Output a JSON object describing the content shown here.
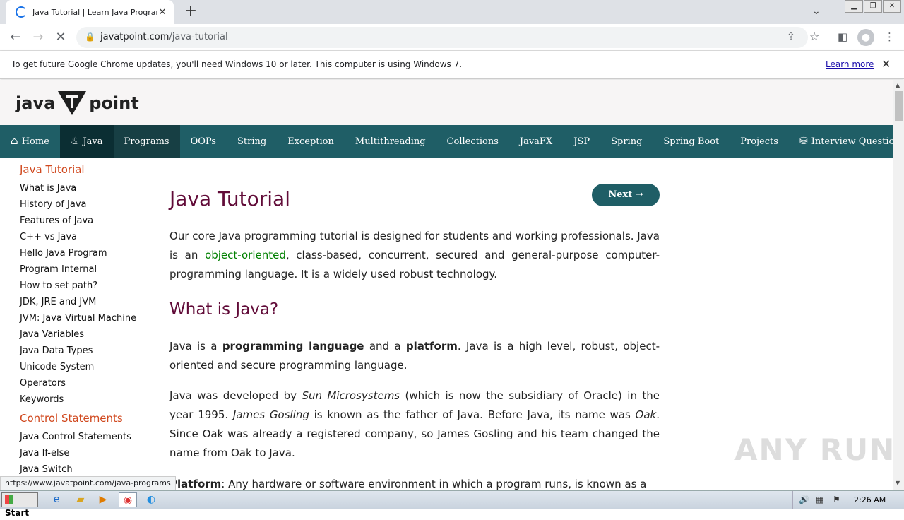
{
  "browser": {
    "tab_title": "Java Tutorial | Learn Java Programm",
    "url_domain": "javatpoint.com",
    "url_path": "/java-tutorial",
    "status_url": "https://www.javatpoint.com/java-programs"
  },
  "infobar": {
    "message": "To get future Google Chrome updates, you'll need Windows 10 or later. This computer is using Windows 7.",
    "learn_more": "Learn more"
  },
  "site": {
    "logo_left": "java",
    "logo_right": "point",
    "menu": [
      {
        "label": "Home",
        "icon": "home-icon"
      },
      {
        "label": "Java",
        "icon": "java-cup-icon"
      },
      {
        "label": "Programs"
      },
      {
        "label": "OOPs"
      },
      {
        "label": "String"
      },
      {
        "label": "Exception"
      },
      {
        "label": "Multithreading"
      },
      {
        "label": "Collections"
      },
      {
        "label": "JavaFX"
      },
      {
        "label": "JSP"
      },
      {
        "label": "Spring"
      },
      {
        "label": "Spring Boot"
      },
      {
        "label": "Projects"
      },
      {
        "label": "Interview Questions",
        "icon": "interview-icon"
      }
    ]
  },
  "sidebar": {
    "heading1": "Java Tutorial",
    "items1": [
      "What is Java",
      "History of Java",
      "Features of Java",
      "C++ vs Java",
      "Hello Java Program",
      "Program Internal",
      "How to set path?",
      "JDK, JRE and JVM",
      "JVM: Java Virtual Machine",
      "Java Variables",
      "Java Data Types",
      "Unicode System",
      "Operators",
      "Keywords"
    ],
    "heading2": "Control Statements",
    "items2": [
      "Java Control Statements",
      "Java If-else",
      "Java Switch"
    ]
  },
  "main": {
    "title": "Java Tutorial",
    "next_label": "Next →",
    "p1_a": "Our core Java programming tutorial is designed for students and working professionals. Java is an ",
    "p1_link": "object-oriented",
    "p1_b": ", class-based, concurrent, secured and general-purpose computer-programming language. It is a widely used robust technology.",
    "h2": "What is Java?",
    "p2_a": "Java is a ",
    "p2_b1": "programming language",
    "p2_c": " and a ",
    "p2_b2": "platform",
    "p2_d": ". Java is a high level, robust, object-oriented and secure programming language.",
    "p3_a": "Java was developed by ",
    "p3_i1": "Sun Microsystems",
    "p3_b": " (which is now the subsidiary of Oracle) in the year 1995. ",
    "p3_i2": "James Gosling",
    "p3_c": " is known as the father of Java. Before Java, its name was ",
    "p3_i3": "Oak",
    "p3_d": ". Since Oak was already a registered company, so James Gosling and his team changed the name from Oak to Java.",
    "p4_b": "Platform",
    "p4_a": ": Any hardware or software environment in which a program runs, is known as a"
  },
  "watermark": "ANY RUN",
  "taskbar": {
    "start": "Start",
    "clock": "2:26 AM"
  }
}
